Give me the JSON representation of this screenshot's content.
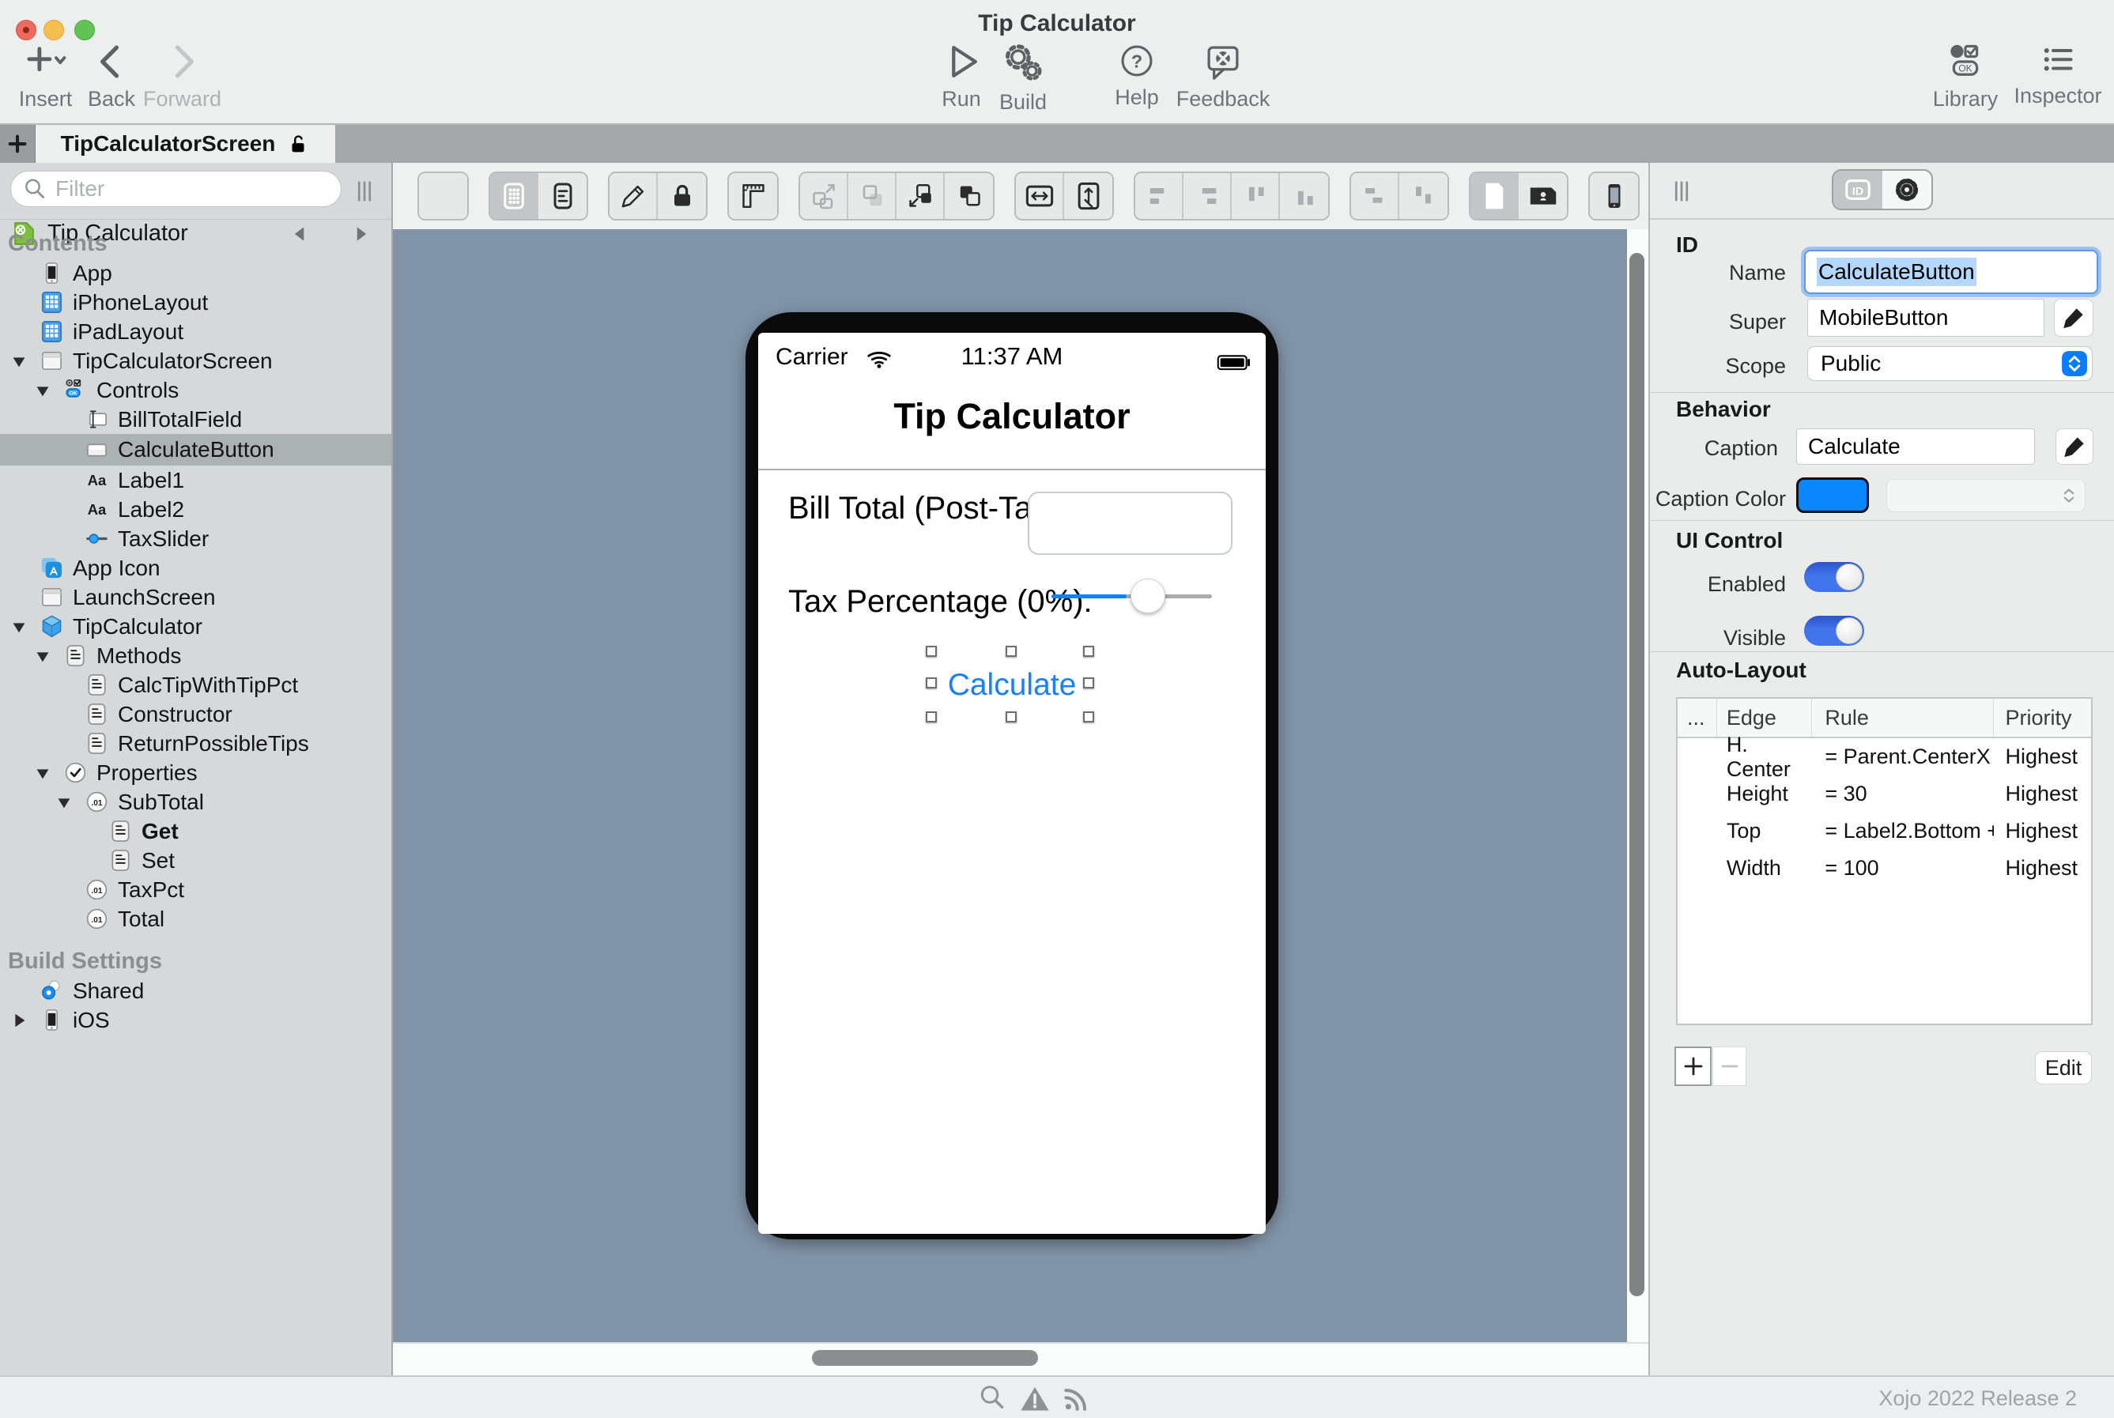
{
  "window": {
    "title": "Tip Calculator",
    "version_text": "Xojo 2022 Release 2"
  },
  "toolbar": {
    "insert_label": "Insert",
    "back_label": "Back",
    "forward_label": "Forward",
    "run_label": "Run",
    "build_label": "Build",
    "help_label": "Help",
    "feedback_label": "Feedback",
    "library_label": "Library",
    "inspector_label": "Inspector"
  },
  "tabbar": {
    "add_tab": "+",
    "active_tab": "TipCalculatorScreen"
  },
  "navigator": {
    "filter_placeholder": "Filter",
    "project_label": "Tip Calculator",
    "sections": [
      {
        "header": "Contents",
        "items": [
          {
            "label": "App",
            "icon": "iphone-device",
            "depth": 1
          },
          {
            "label": "iPhoneLayout",
            "icon": "layout-grid",
            "depth": 1
          },
          {
            "label": "iPadLayout",
            "icon": "layout-grid",
            "depth": 1
          },
          {
            "label": "TipCalculatorScreen",
            "icon": "screen-window",
            "depth": 1,
            "disclosure": "down"
          },
          {
            "label": "Controls",
            "icon": "controls-group",
            "depth": 2,
            "disclosure": "down"
          },
          {
            "label": "BillTotalField",
            "icon": "textfield-control",
            "depth": 3
          },
          {
            "label": "CalculateButton",
            "icon": "button-control",
            "depth": 3,
            "selected": true
          },
          {
            "label": "Label1",
            "icon": "label-control",
            "depth": 3
          },
          {
            "label": "Label2",
            "icon": "label-control",
            "depth": 3
          },
          {
            "label": "TaxSlider",
            "icon": "slider-control",
            "depth": 3
          },
          {
            "label": "App Icon",
            "icon": "app-icon",
            "depth": 1
          },
          {
            "label": "LaunchScreen",
            "icon": "screen-window",
            "depth": 1
          },
          {
            "label": "TipCalculator",
            "icon": "class-cube",
            "depth": 1,
            "disclosure": "down"
          },
          {
            "label": "Methods",
            "icon": "method-doc",
            "depth": 2,
            "disclosure": "down"
          },
          {
            "label": "CalcTipWithTipPct",
            "icon": "method-doc",
            "depth": 3
          },
          {
            "label": "Constructor",
            "icon": "method-doc",
            "depth": 3
          },
          {
            "label": "ReturnPossibleTips",
            "icon": "method-doc",
            "depth": 3
          },
          {
            "label": "Properties",
            "icon": "prop-check-circle",
            "depth": 2,
            "disclosure": "down"
          },
          {
            "label": "SubTotal",
            "icon": "property-circle",
            "depth": 3,
            "disclosure": "down"
          },
          {
            "label": "Get",
            "icon": "method-doc",
            "depth": 4,
            "bold": true
          },
          {
            "label": "Set",
            "icon": "method-doc",
            "depth": 4
          },
          {
            "label": "TaxPct",
            "icon": "property-circle",
            "depth": 3
          },
          {
            "label": "Total",
            "icon": "property-circle",
            "depth": 3
          }
        ]
      },
      {
        "header": "Build Settings",
        "items": [
          {
            "label": "Shared",
            "icon": "radio-shared",
            "depth": 1
          },
          {
            "label": "iOS",
            "icon": "iphone-device",
            "depth": 1,
            "disclosure": "right"
          }
        ]
      }
    ]
  },
  "editor_toolbar": {
    "groups": [
      {
        "segmented": false,
        "buttons": [
          {
            "icon": "add-control"
          }
        ]
      },
      {
        "segmented": true,
        "buttons": [
          {
            "icon": "layout-view",
            "selected": true
          },
          {
            "icon": "code-view"
          }
        ]
      },
      {
        "segmented": true,
        "buttons": [
          {
            "icon": "pencil"
          },
          {
            "icon": "lock"
          }
        ]
      },
      {
        "segmented": false,
        "buttons": [
          {
            "icon": "ruler"
          }
        ]
      },
      {
        "segmented": true,
        "buttons": [
          {
            "icon": "move-to-back",
            "disabled": true
          },
          {
            "icon": "move-backward",
            "disabled": true
          },
          {
            "icon": "move-forward"
          },
          {
            "icon": "move-to-front"
          }
        ]
      },
      {
        "segmented": true,
        "buttons": [
          {
            "icon": "equal-width"
          },
          {
            "icon": "equal-height"
          }
        ]
      },
      {
        "segmented": true,
        "buttons": [
          {
            "icon": "align-left",
            "disabled": true
          },
          {
            "icon": "align-right",
            "disabled": true
          },
          {
            "icon": "align-top",
            "disabled": true
          },
          {
            "icon": "align-bottom",
            "disabled": true
          }
        ]
      },
      {
        "segmented": true,
        "buttons": [
          {
            "icon": "space-horizontal",
            "disabled": true
          },
          {
            "icon": "space-vertical",
            "disabled": true
          }
        ]
      },
      {
        "segmented": true,
        "buttons": [
          {
            "icon": "orientation-portrait",
            "selected": true
          },
          {
            "icon": "orientation-landscape"
          }
        ]
      },
      {
        "segmented": false,
        "buttons": [
          {
            "icon": "device-phone"
          }
        ]
      }
    ]
  },
  "phone": {
    "carrier": "Carrier",
    "time": "11:37 AM",
    "screen_title": "Tip Calculator",
    "bill_label": "Bill Total (Post-Tax):",
    "bill_field_value": "",
    "tax_label": "Tax Percentage (0%):",
    "button_caption": "Calculate",
    "slider_fill_pct": 47
  },
  "inspector": {
    "id_section": {
      "header": "ID",
      "name_label": "Name",
      "name_value": "CalculateButton",
      "super_label": "Super",
      "super_value": "MobileButton",
      "scope_label": "Scope",
      "scope_value": "Public"
    },
    "behavior_section": {
      "header": "Behavior",
      "caption_label": "Caption",
      "caption_value": "Calculate",
      "caption_color_label": "Caption Color",
      "caption_color_value": "#0A86FF"
    },
    "ui_control_section": {
      "header": "UI Control",
      "enabled_label": "Enabled",
      "enabled_value": true,
      "visible_label": "Visible",
      "visible_value": true
    },
    "auto_layout_section": {
      "header": "Auto-Layout",
      "table_headers": [
        "...",
        "Edge",
        "Rule",
        "Priority"
      ],
      "rows": [
        {
          "edge": "H. Center",
          "rule": "= Parent.CenterX",
          "priority": "Highest"
        },
        {
          "edge": "Height",
          "rule": "=  30",
          "priority": "Highest"
        },
        {
          "edge": "Top",
          "rule": "= Label2.Bottom +...",
          "priority": "Highest"
        },
        {
          "edge": "Width",
          "rule": "=  100",
          "priority": "Highest"
        }
      ],
      "add_label": "+",
      "remove_label": "−",
      "edit_label": "Edit"
    }
  },
  "colors": {
    "canvas_background": "#8093A7",
    "accent_blue": "#0A86FF",
    "toggle_blue": "#4173EA",
    "phone_button_blue": "#1980F8",
    "selection_highlight": "#B3D7FD"
  }
}
